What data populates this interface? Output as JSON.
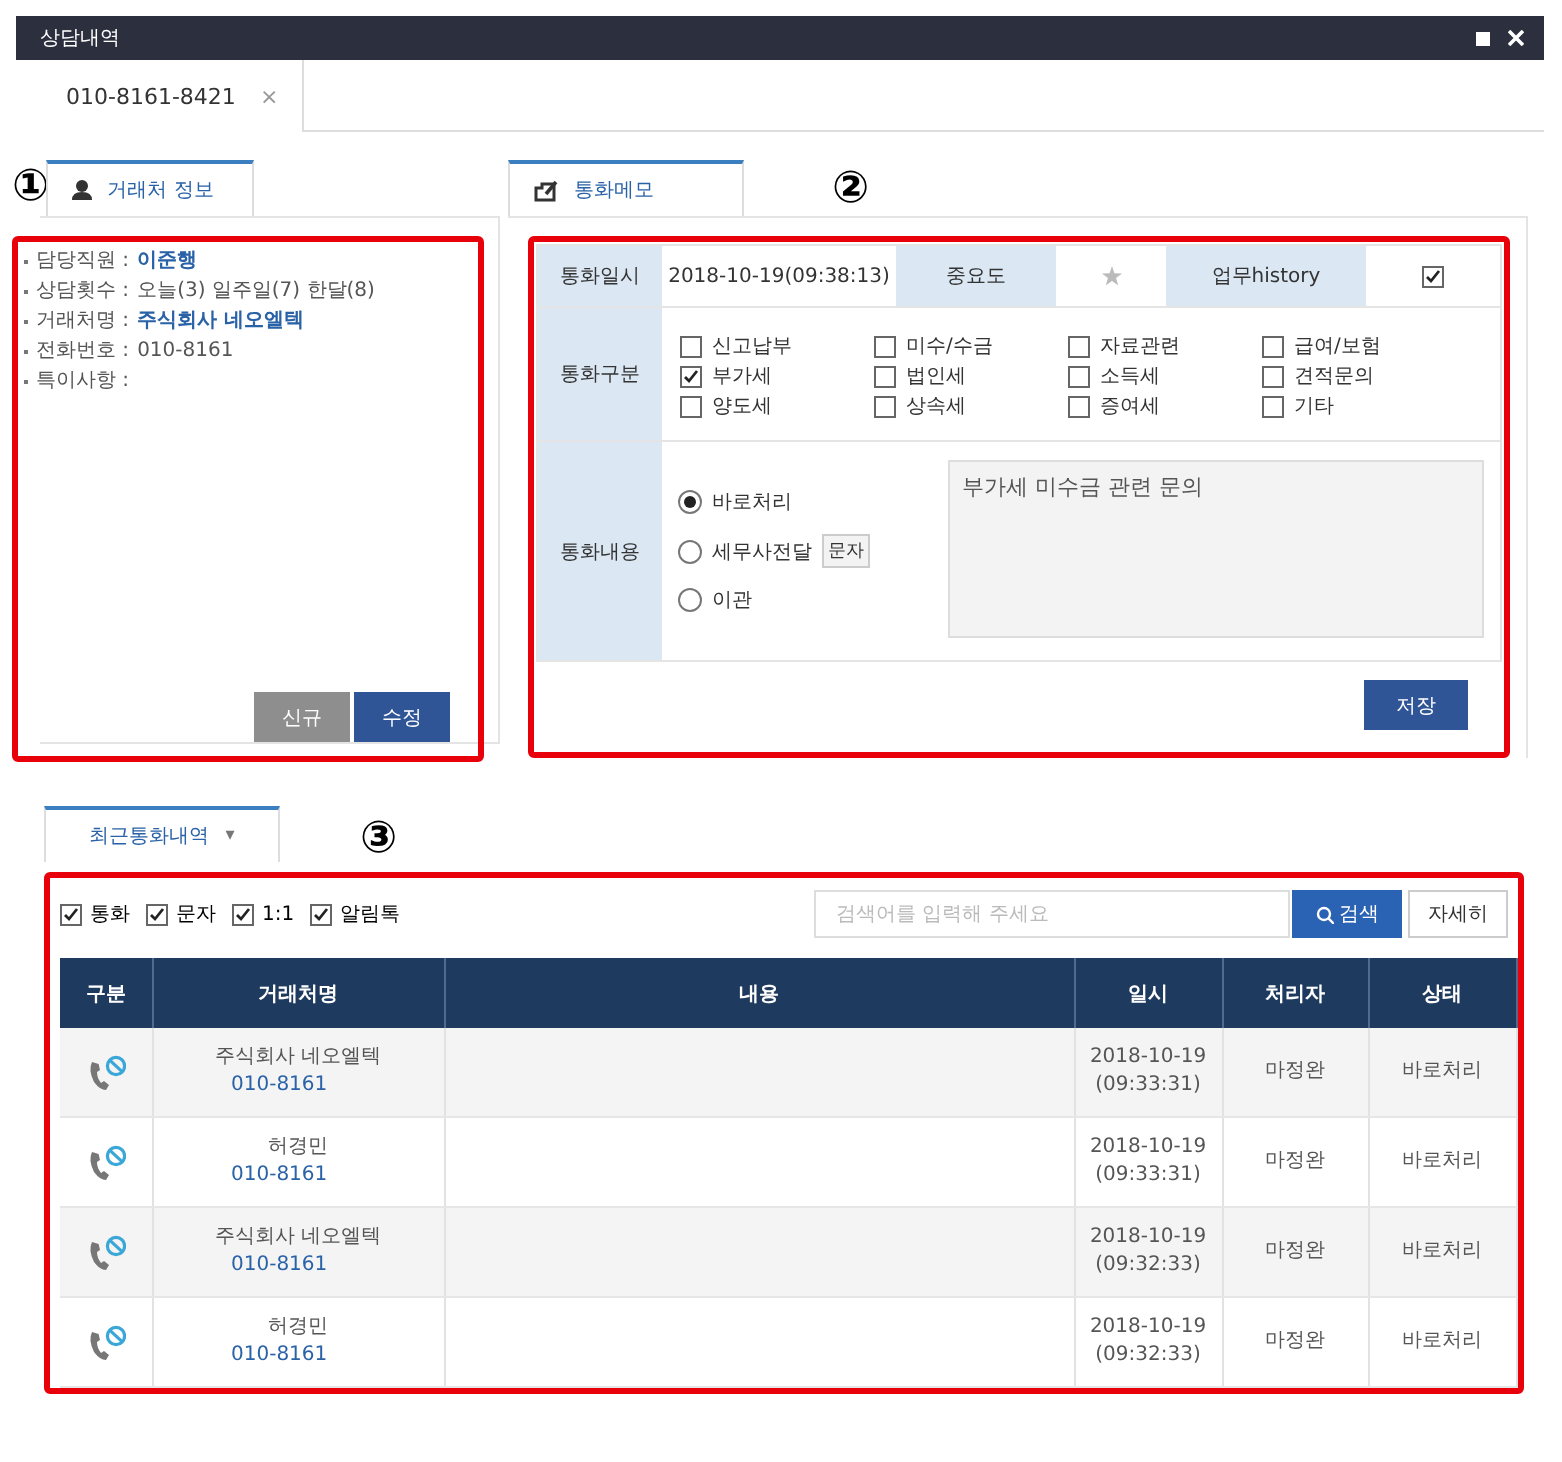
{
  "window": {
    "title": "상담내역"
  },
  "tabs": [
    {
      "label": "010-8161-8421",
      "close": "×",
      "selected": true
    }
  ],
  "client_panel": {
    "marker": "①",
    "tab": "거래처 정보",
    "selected": true,
    "fields": [
      {
        "label": "담당직원 :",
        "value": "이준행",
        "kind": "link"
      },
      {
        "label": "상담횟수 :",
        "value": "오늘(3) 일주일(7) 한달(8)",
        "kind": "plain"
      },
      {
        "label": "거래처명 :",
        "value": "주식회사 네오엘텍",
        "kind": "link"
      },
      {
        "label": "전화번호 :",
        "value": "010-8161",
        "kind": "plain"
      },
      {
        "label": "특이사항 :"
      }
    ],
    "buttons": [
      {
        "label": "신규",
        "kind": "secondary"
      },
      {
        "label": "수정",
        "kind": "primary"
      }
    ]
  },
  "memo_panel": {
    "marker": "②",
    "tab": "통화메모",
    "selected": true,
    "datetime_label": "통화일시",
    "datetime": "2018-10-19(09:38:13)",
    "importance_label": "중요도",
    "starred": false,
    "history_label": "업무history",
    "history_checked": true,
    "category_label": "통화구분",
    "categories": [
      {
        "label": "신고납부",
        "checked": false
      },
      {
        "label": "미수/수금",
        "checked": false
      },
      {
        "label": "자료관련",
        "checked": false
      },
      {
        "label": "급여/보험",
        "checked": false
      },
      {
        "label": "부가세",
        "checked": true
      },
      {
        "label": "법인세",
        "checked": false
      },
      {
        "label": "소득세",
        "checked": false
      },
      {
        "label": "견적문의",
        "checked": false
      },
      {
        "label": "양도세",
        "checked": false
      },
      {
        "label": "상속세",
        "checked": false
      },
      {
        "label": "증여세",
        "checked": false
      },
      {
        "label": "기타",
        "checked": false
      }
    ],
    "content_label": "통화내용",
    "dispositions": [
      {
        "label": "바로처리",
        "selected": true
      },
      {
        "label": "세무사전달",
        "selected": false,
        "button": "문자"
      },
      {
        "label": "이관",
        "selected": false
      }
    ],
    "memo": "부가세 미수금 관련 문의",
    "save": "저장"
  },
  "history": {
    "marker": "③",
    "tab": "최근통화내역",
    "tab_caret": "▾",
    "selected": true,
    "filters": [
      {
        "label": "통화",
        "checked": true
      },
      {
        "label": "문자",
        "checked": true
      },
      {
        "label": "1:1",
        "checked": true
      },
      {
        "label": "알림톡",
        "checked": true
      }
    ],
    "search": {
      "placeholder": "검색어를 입력해 주세요"
    },
    "search_button": "검색",
    "detail_button": "자세히",
    "columns": [
      "구분",
      "거래처명",
      "내용",
      "일시",
      "처리자",
      "상태"
    ],
    "rows": [
      {
        "company": "주식회사 네오엘텍",
        "phone": "010-8161",
        "date": "2018-10-19",
        "time": "(09:33:31)",
        "handler": "마정완",
        "status": "바로처리"
      },
      {
        "company": "허경민",
        "phone": "010-8161",
        "date": "2018-10-19",
        "time": "(09:33:31)",
        "handler": "마정완",
        "status": "바로처리"
      },
      {
        "company": "주식회사 네오엘텍",
        "phone": "010-8161",
        "date": "2018-10-19",
        "time": "(09:32:33)",
        "handler": "마정완",
        "status": "바로처리"
      },
      {
        "company": "허경민",
        "phone": "010-8161",
        "date": "2018-10-19",
        "time": "(09:32:33)",
        "handler": "마정완",
        "status": "바로처리"
      }
    ]
  }
}
